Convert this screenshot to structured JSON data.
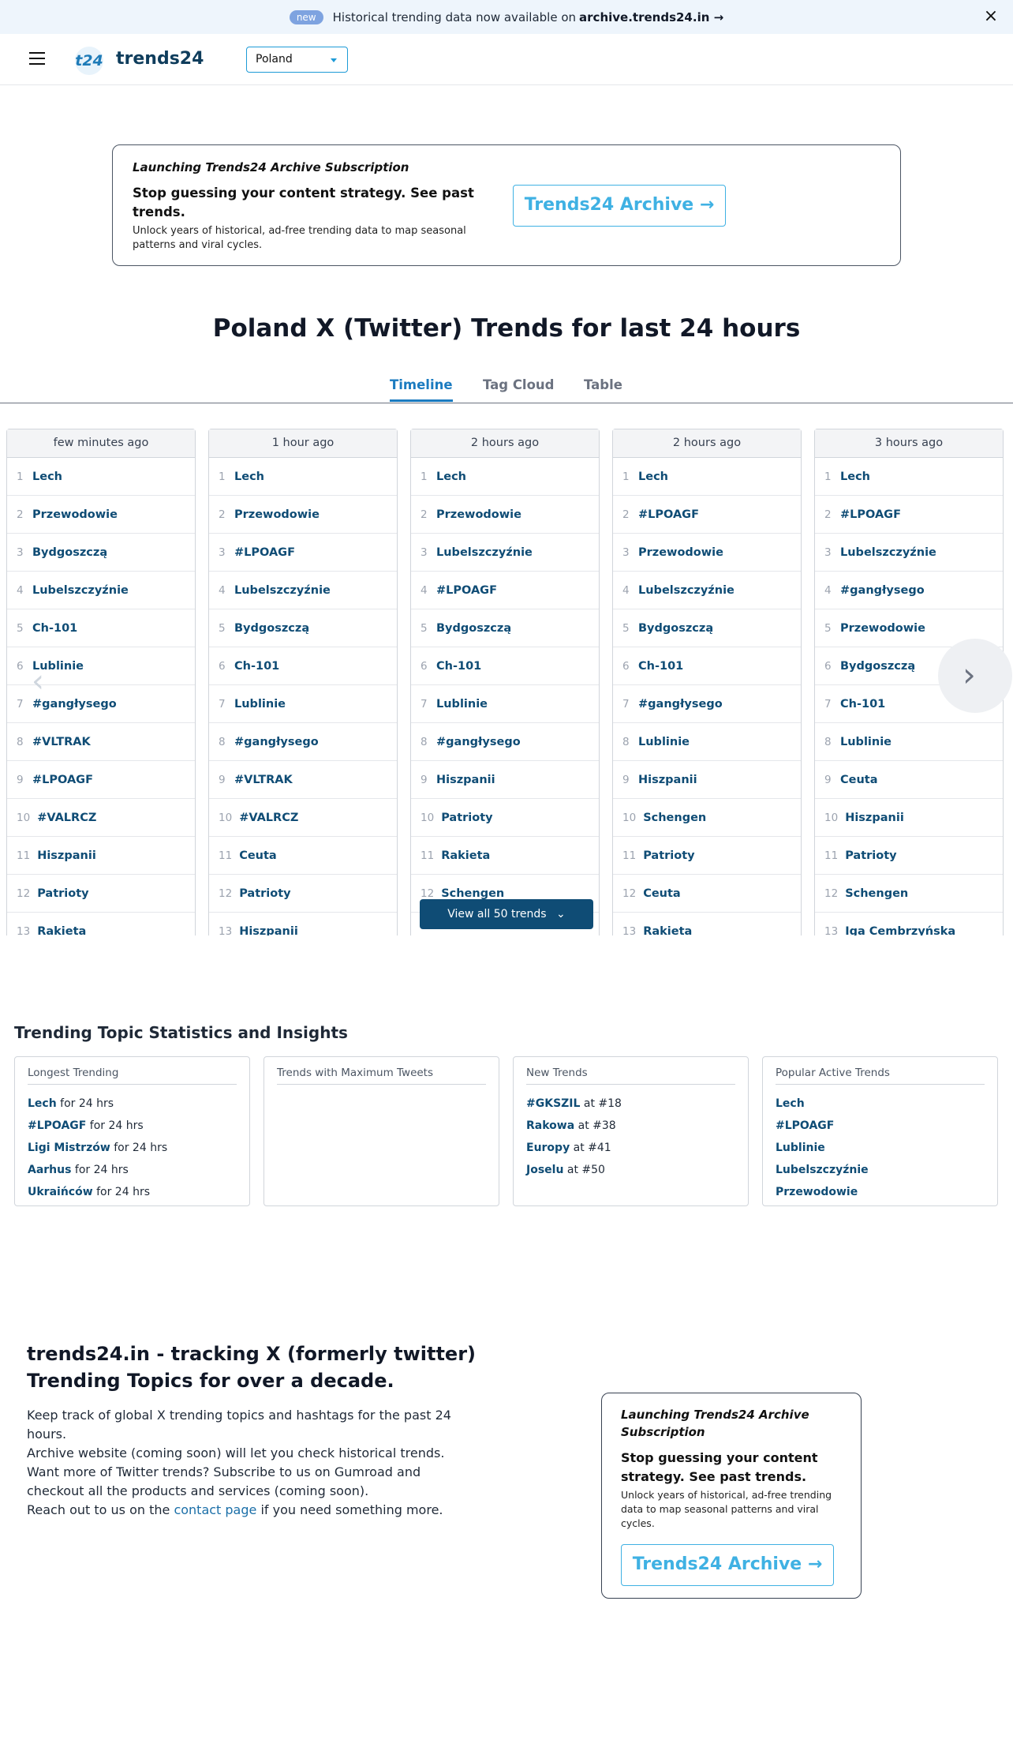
{
  "announcement": {
    "badge": "new",
    "text": "Historical trending data now available on",
    "link": "archive.trends24.in →",
    "close_icon": "close-icon"
  },
  "header": {
    "menu_icon": "hamburger-icon",
    "logo_mark": "t24",
    "logo_text": "trends24",
    "country": "Poland"
  },
  "promo": {
    "kicker": "Launching Trends24 Archive Subscription",
    "headline": "Stop guessing your content strategy. See past trends.",
    "sub": "Unlock years of historical, ad-free trending data to map seasonal patterns and viral cycles.",
    "button": "Trends24 Archive →"
  },
  "page_title": "Poland X (Twitter) Trends for last 24 hours",
  "tabs": [
    "Timeline",
    "Tag Cloud",
    "Table"
  ],
  "timeline": {
    "columns": [
      {
        "time": "few minutes ago",
        "trends": [
          "Lech",
          "Przewodowie",
          "Bydgoszczą",
          "Lubelszczyźnie",
          "Ch-101",
          "Lublinie",
          "#gangłysego",
          "#VLTRAK",
          "#LPOAGF",
          "#VALRCZ",
          "Hiszpanii",
          "Patrioty",
          "Rakieta"
        ]
      },
      {
        "time": "1 hour ago",
        "trends": [
          "Lech",
          "Przewodowie",
          "#LPOAGF",
          "Lubelszczyźnie",
          "Bydgoszczą",
          "Ch-101",
          "Lublinie",
          "#gangłysego",
          "#VLTRAK",
          "#VALRCZ",
          "Ceuta",
          "Patrioty",
          "Hiszpanii"
        ]
      },
      {
        "time": "2 hours ago",
        "trends": [
          "Lech",
          "Przewodowie",
          "Lubelszczyźnie",
          "#LPOAGF",
          "Bydgoszczą",
          "Ch-101",
          "Lublinie",
          "#gangłysego",
          "Hiszpanii",
          "Patrioty",
          "Rakieta",
          "Schengen"
        ]
      },
      {
        "time": "2 hours ago",
        "trends": [
          "Lech",
          "#LPOAGF",
          "Przewodowie",
          "Lubelszczyźnie",
          "Bydgoszczą",
          "Ch-101",
          "#gangłysego",
          "Lublinie",
          "Hiszpanii",
          "Schengen",
          "Patrioty",
          "Ceuta",
          "Rakieta"
        ]
      },
      {
        "time": "3 hours ago",
        "trends": [
          "Lech",
          "#LPOAGF",
          "Lubelszczyźnie",
          "#gangłysego",
          "Przewodowie",
          "Bydgoszczą",
          "Ch-101",
          "Lublinie",
          "Ceuta",
          "Hiszpanii",
          "Patrioty",
          "Schengen",
          "Iga Cembrzyńska"
        ]
      }
    ],
    "view_all": "View all 50 trends",
    "prev_icon": "chevron-left-icon",
    "next_icon": "chevron-right-icon"
  },
  "stats": {
    "title": "Trending Topic Statistics and Insights",
    "cards": [
      {
        "title": "Longest Trending",
        "items": [
          {
            "name": "Lech",
            "suffix": " for 24 hrs"
          },
          {
            "name": "#LPOAGF",
            "suffix": " for 24 hrs"
          },
          {
            "name": "Ligi Mistrzów",
            "suffix": " for 24 hrs"
          },
          {
            "name": "Aarhus",
            "suffix": " for 24 hrs"
          },
          {
            "name": "Ukraińców",
            "suffix": " for 24 hrs"
          }
        ]
      },
      {
        "title": "Trends with Maximum Tweets",
        "items": []
      },
      {
        "title": "New Trends",
        "items": [
          {
            "name": "#GKSZIL",
            "suffix": " at #18"
          },
          {
            "name": "Rakowa",
            "suffix": " at #38"
          },
          {
            "name": "Europy",
            "suffix": " at #41"
          },
          {
            "name": "Joselu",
            "suffix": " at #50"
          }
        ]
      },
      {
        "title": "Popular Active Trends",
        "items": [
          {
            "name": "Lech",
            "suffix": ""
          },
          {
            "name": "#LPOAGF",
            "suffix": ""
          },
          {
            "name": "Lublinie",
            "suffix": ""
          },
          {
            "name": "Lubelszczyźnie",
            "suffix": ""
          },
          {
            "name": "Przewodowie",
            "suffix": ""
          }
        ]
      }
    ]
  },
  "about": {
    "title": "trends24.in - tracking X (formerly twitter) Trending Topics for over a decade.",
    "p1": "Keep track of global X trending topics and hashtags for the past 24 hours.",
    "p2": "Archive website (coming soon) will let you check historical trends.",
    "p3": "Want more of Twitter trends? Subscribe to us on Gumroad and checkout all the products and services (coming soon).",
    "p4_pre": "Reach out to us on the ",
    "p4_link": "contact page",
    "p4_post": " if you need something more."
  },
  "colors": {
    "accent": "#1b7bc0",
    "link": "#0f4c75",
    "archive_button": "#3fb1e3",
    "announce_bg": "#eef5fc"
  }
}
